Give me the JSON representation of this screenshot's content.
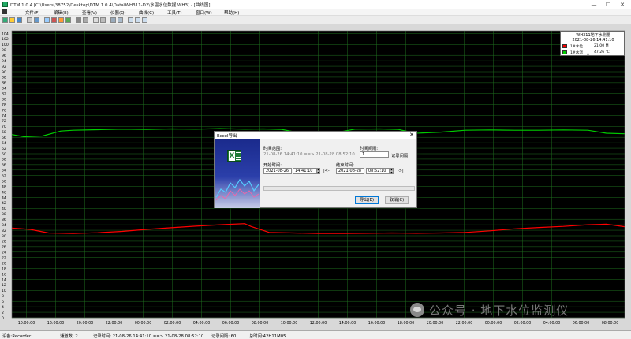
{
  "window": {
    "title": "DTM 1.0.4 [C:\\Users\\38752\\Desktop\\DTM 1.0.4\\Data\\WH311-D2\\水温水位数据.WH3] - [曲线图]",
    "minimize": "—",
    "maximize": "☐",
    "close": "✕"
  },
  "menu": [
    "文件(F)",
    "编辑(E)",
    "查看(V)",
    "仪器(Q)",
    "曲线(C)",
    "工具(T)",
    "窗口(W)",
    "帮助(H)"
  ],
  "chart_data": {
    "type": "line",
    "y_ticks": [
      0,
      2,
      4,
      6,
      8,
      10,
      12,
      14,
      16,
      18,
      20,
      22,
      24,
      26,
      28,
      30,
      32,
      34,
      36,
      38,
      40,
      42,
      44,
      46,
      48,
      50,
      52,
      54,
      56,
      58,
      60,
      62,
      64,
      66,
      68,
      70,
      72,
      74,
      76,
      78,
      80,
      82,
      84,
      86,
      88,
      90,
      92,
      94,
      96,
      98,
      100,
      102,
      104
    ],
    "ylim": [
      0,
      105
    ],
    "x_ticks": [
      "10:00:00",
      "16:00:00",
      "20:00:00",
      "22:00:00",
      "00:00:00",
      "02:00:00",
      "04:00:00",
      "06:00:00",
      "08:00:00",
      "10:00:00",
      "12:00:00",
      "14:00:00",
      "16:00:00",
      "18:00:00",
      "20:00:00",
      "22:00:00",
      "00:00:00",
      "02:00:00",
      "04:00:00",
      "06:00:00",
      "08:00:00"
    ],
    "grid": true,
    "background": "#000000",
    "grid_color": "#1f6f1f",
    "legend_position": "top-right",
    "series": [
      {
        "name": "1#水位",
        "color": "#00cc00",
        "x": [
          0,
          0.02,
          0.05,
          0.08,
          0.1,
          0.14,
          0.18,
          0.22,
          0.26,
          0.3,
          0.34,
          0.38,
          0.41,
          0.44,
          0.48,
          0.52,
          0.56,
          0.6,
          0.63,
          0.66,
          0.7,
          0.74,
          0.78,
          0.82,
          0.86,
          0.9,
          0.94,
          0.97,
          1.0
        ],
        "y": [
          67.0,
          66.2,
          66.5,
          68.3,
          68.6,
          68.8,
          69.0,
          68.9,
          69.1,
          69.0,
          69.2,
          69.0,
          69.1,
          68.9,
          67.2,
          67.4,
          69.0,
          69.1,
          68.9,
          67.5,
          67.9,
          68.6,
          68.7,
          68.6,
          68.6,
          68.7,
          68.6,
          67.5,
          67.3
        ]
      },
      {
        "name": "1#水温",
        "color": "#ff0000",
        "x": [
          0,
          0.03,
          0.06,
          0.1,
          0.14,
          0.18,
          0.22,
          0.26,
          0.3,
          0.34,
          0.38,
          0.39,
          0.42,
          0.46,
          0.5,
          0.54,
          0.58,
          0.62,
          0.66,
          0.7,
          0.74,
          0.78,
          0.82,
          0.86,
          0.9,
          0.94,
          0.97,
          1.0
        ],
        "y": [
          32.8,
          32.3,
          31.0,
          30.8,
          31.1,
          31.6,
          32.3,
          32.9,
          33.5,
          34.0,
          34.4,
          33.4,
          31.2,
          31.0,
          30.8,
          30.8,
          30.9,
          31.0,
          30.9,
          31.0,
          31.2,
          31.8,
          32.5,
          33.0,
          33.4,
          34.0,
          34.2,
          33.3
        ]
      }
    ]
  },
  "legend": {
    "title": "WH311地下水测量",
    "time": "2021-08-26 14:41:10",
    "rows": [
      {
        "channel": "1#水位",
        "value": "21.00 M",
        "color": "#ff0000"
      },
      {
        "channel": "1#水温",
        "value": "47.26 ℃",
        "color": "#00cc00"
      }
    ]
  },
  "dialog": {
    "title": "Excel导出",
    "close": "✕",
    "range_label": "时间范围:",
    "range_value": "21-08-26 14:41:10 ==> 21-08-28 08:52:10",
    "interval_label": "时间间隔:",
    "interval_value": "1",
    "interval_unit": "记录间隔",
    "start_label": "开始时间:",
    "start_date": "2021-08-26",
    "start_time": "14:41:10",
    "start_nav": "|<-",
    "end_label": "结束时间:",
    "end_date": "2021-08-28",
    "end_time": "08:52:10",
    "end_nav": "->|",
    "export_button": "导出(E)",
    "cancel_button": "取消(C)",
    "progress": 0
  },
  "statusbar": {
    "device": "设备:Recorder",
    "channels": "通道数: 2",
    "record_time": "记录时间: 21-08-26 14:41:10 ==> 21-08-28 08:52:10",
    "interval": "记录间隔: 60",
    "total": "总时间:42H11M05"
  },
  "watermark": "公众号 · 地下水位监测仪"
}
